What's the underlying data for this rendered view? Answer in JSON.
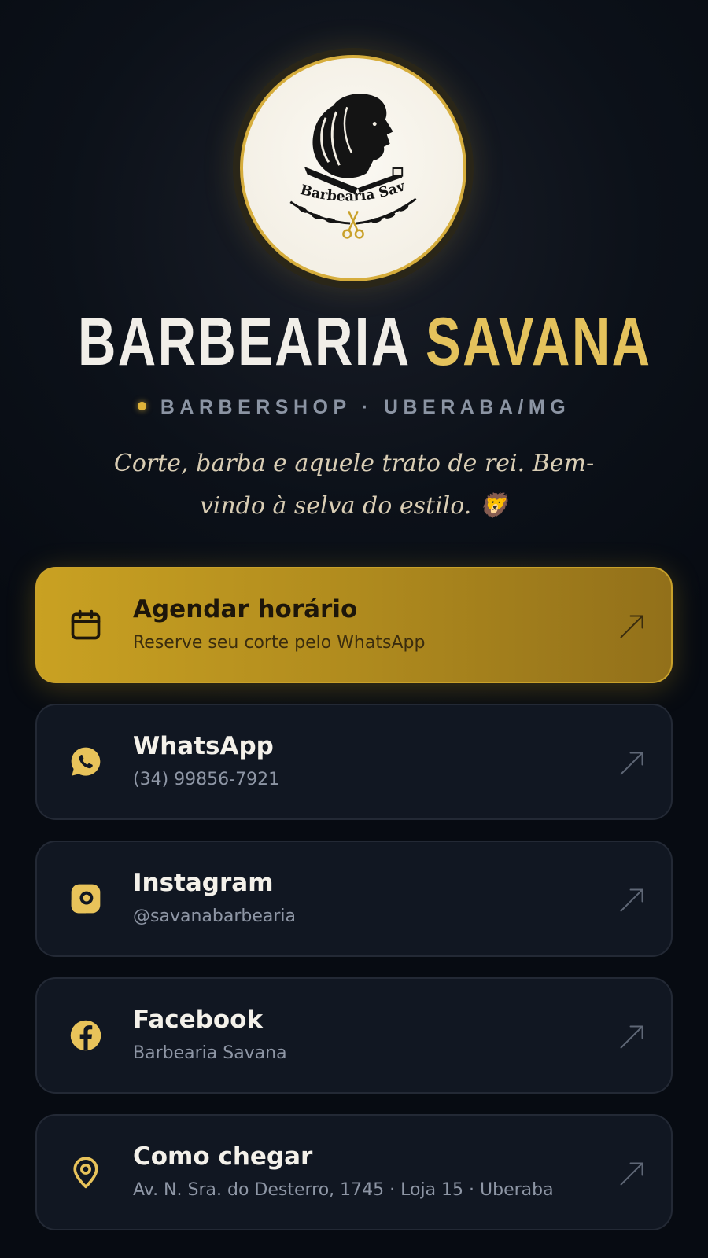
{
  "profile": {
    "title_main": "BARBEARIA",
    "title_accent": "SAVANA",
    "tagline": "BARBERSHOP · UBERABA/MG",
    "bio": "Corte, barba e aquele trato de rei. Bem-vindo à selva do estilo. 🦁",
    "logo_text": "Barbearia Savana",
    "logo_icon": "lion-razor-logo"
  },
  "colors": {
    "accent": "#e4c25c",
    "gold_button": "#c9a122",
    "background": "#0c1119",
    "card": "#111722"
  },
  "links": [
    {
      "label": "Agendar horário",
      "subtitle": "Reserve seu corte pelo WhatsApp",
      "icon": "calendar-icon",
      "primary": true
    },
    {
      "label": "WhatsApp",
      "subtitle": "(34) 99856-7921",
      "icon": "whatsapp-icon",
      "primary": false
    },
    {
      "label": "Instagram",
      "subtitle": "@savanabarbearia",
      "icon": "instagram-icon",
      "primary": false
    },
    {
      "label": "Facebook",
      "subtitle": "Barbearia Savana",
      "icon": "facebook-icon",
      "primary": false
    },
    {
      "label": "Como chegar",
      "subtitle": "Av. N. Sra. do Desterro, 1745 · Loja 15 · Uberaba",
      "icon": "map-pin-icon",
      "primary": false
    }
  ]
}
